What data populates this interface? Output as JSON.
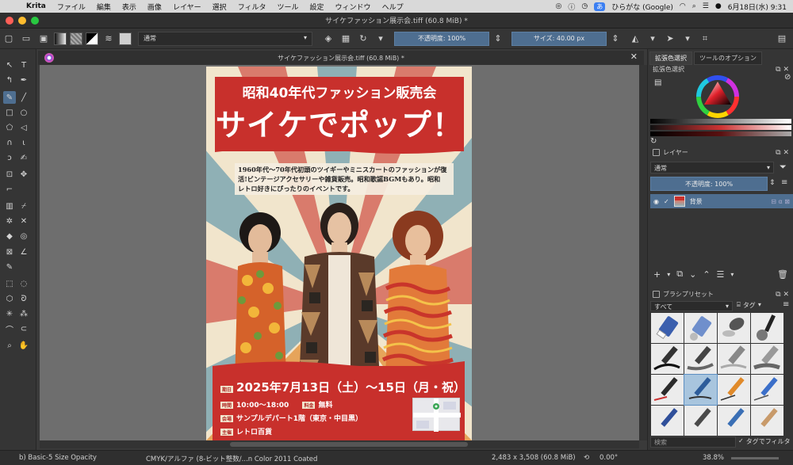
{
  "menubar": {
    "app": "Krita",
    "items": [
      "ファイル",
      "編集",
      "表示",
      "画像",
      "レイヤー",
      "選択",
      "フィルタ",
      "ツール",
      "設定",
      "ウィンドウ",
      "ヘルプ"
    ],
    "ime": "あ",
    "ime_label": "ひらがな (Google)",
    "clock": "6月18日(水) 9:31"
  },
  "window": {
    "title": "サイケファッション展示会.tiff (60.8 MiB) *"
  },
  "toolbar": {
    "blend_mode": "通常",
    "opacity": "不透明度: 100%",
    "size": "サイズ: 40.00 px"
  },
  "document": {
    "tab_title": "サイケファッション展示会.tiff (60.8 MiB) *"
  },
  "poster": {
    "headline": "昭和40年代ファッション販売会",
    "big_title": "サイケでポップ！",
    "desc_lines": [
      "1960年代〜70年代初頭のツイギーやミニスカートのファッションが復",
      "活!ビンテージアクセサリーや雑貨販売。昭和歌謡BGMもあり。昭和",
      "レトロ好きにぴったりのイベントです。"
    ],
    "date_tag": "期日",
    "date": "2025年7月13日（土）〜15日（月・祝）",
    "time_tag": "時間",
    "time": "10:00〜18:00",
    "fee_tag": "料金",
    "fee": "無料",
    "venue_tag": "会場",
    "venue": "サンプルデパート1階（東京・中目黒）",
    "host_tag": "主催",
    "host": "レトロ百貨"
  },
  "dockers": {
    "color_tabs": [
      "拡張色選択",
      "ツールのオプション"
    ],
    "color_title": "拡張色選択",
    "layers_title": "レイヤー",
    "layer_blend": "通常",
    "layer_opacity": "不透明度: 100%",
    "layer_name": "背景",
    "brush_title": "ブラシプリセット",
    "brush_filter": "すべて",
    "brush_tag": "タグ",
    "search_placeholder": "検索",
    "tag_filter": "タグでフィルタ"
  },
  "status": {
    "brush": "b) Basic-5 Size Opacity",
    "color_space": "CMYK/アルファ (8-ビット整数/...n Color 2011 Coated",
    "dimensions": "2,483 x 3,508 (60.8 MiB)",
    "rotation": "0.00°",
    "zoom": "38.8%"
  },
  "colors": {
    "accent": "#4e6e90",
    "poster_red": "#c8302c",
    "poster_cream": "#f1e5cc"
  }
}
